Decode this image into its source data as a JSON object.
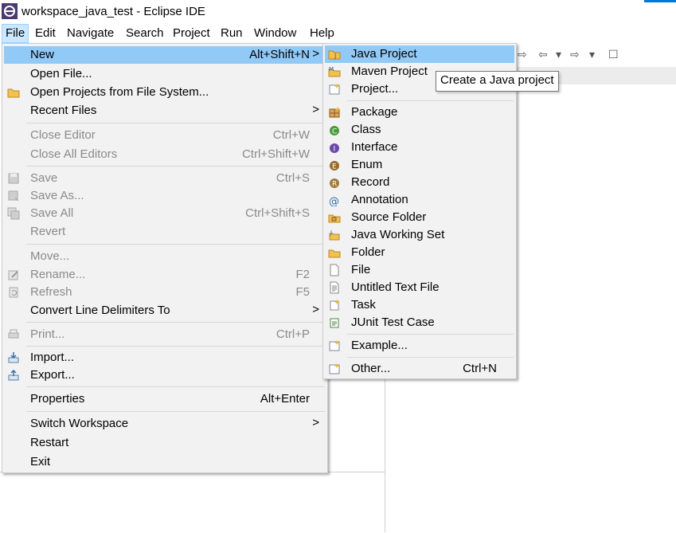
{
  "window": {
    "title": "workspace_java_test - Eclipse IDE"
  },
  "menubar": {
    "items": [
      "File",
      "Edit",
      "Navigate",
      "Search",
      "Project",
      "Run",
      "Window",
      "Help"
    ]
  },
  "file_menu": {
    "new": {
      "label": "New",
      "shortcut": "Alt+Shift+N"
    },
    "open_file": {
      "label": "Open File..."
    },
    "open_projects": {
      "label": "Open Projects from File System..."
    },
    "recent_files": {
      "label": "Recent Files"
    },
    "close_editor": {
      "label": "Close Editor",
      "shortcut": "Ctrl+W"
    },
    "close_all_editors": {
      "label": "Close All Editors",
      "shortcut": "Ctrl+Shift+W"
    },
    "save": {
      "label": "Save",
      "shortcut": "Ctrl+S"
    },
    "save_as": {
      "label": "Save As..."
    },
    "save_all": {
      "label": "Save All",
      "shortcut": "Ctrl+Shift+S"
    },
    "revert": {
      "label": "Revert"
    },
    "move": {
      "label": "Move..."
    },
    "rename": {
      "label": "Rename...",
      "shortcut": "F2"
    },
    "refresh": {
      "label": "Refresh",
      "shortcut": "F5"
    },
    "convert_line_delimiters": {
      "label": "Convert Line Delimiters To"
    },
    "print": {
      "label": "Print...",
      "shortcut": "Ctrl+P"
    },
    "import": {
      "label": "Import..."
    },
    "export": {
      "label": "Export..."
    },
    "properties": {
      "label": "Properties",
      "shortcut": "Alt+Enter"
    },
    "switch_workspace": {
      "label": "Switch Workspace"
    },
    "restart": {
      "label": "Restart"
    },
    "exit": {
      "label": "Exit"
    }
  },
  "new_menu": {
    "java_project": {
      "label": "Java Project"
    },
    "maven_project": {
      "label": "Maven Project"
    },
    "project": {
      "label": "Project..."
    },
    "package": {
      "label": "Package"
    },
    "class": {
      "label": "Class"
    },
    "interface": {
      "label": "Interface"
    },
    "enum": {
      "label": "Enum"
    },
    "record": {
      "label": "Record"
    },
    "annotation": {
      "label": "Annotation"
    },
    "source_folder": {
      "label": "Source Folder"
    },
    "java_working_set": {
      "label": "Java Working Set"
    },
    "folder": {
      "label": "Folder"
    },
    "file": {
      "label": "File"
    },
    "untitled_text_file": {
      "label": "Untitled Text File"
    },
    "task": {
      "label": "Task"
    },
    "junit_test_case": {
      "label": "JUnit Test Case"
    },
    "example": {
      "label": "Example..."
    },
    "other": {
      "label": "Other...",
      "shortcut": "Ctrl+N"
    }
  },
  "tooltip": {
    "text": "Create a Java project"
  },
  "submenu_arrow": ">",
  "colors": {
    "highlight": "#91c9f7",
    "menu_bg": "#f2f2f2",
    "accent": "#0078d7"
  }
}
